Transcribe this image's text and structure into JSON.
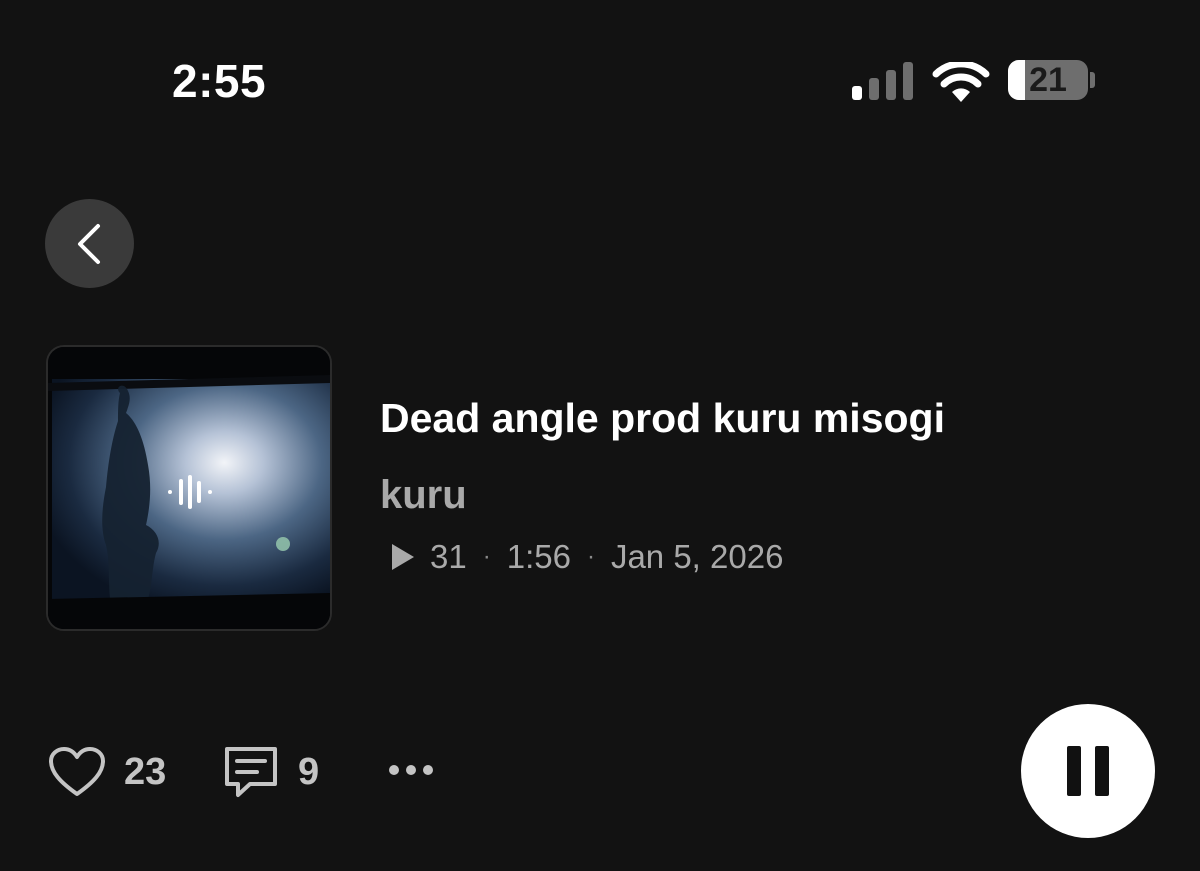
{
  "status_bar": {
    "time": "2:55",
    "battery_level": "21",
    "battery_fraction": 0.21,
    "icons": [
      "cellular-signal-icon",
      "wifi-icon",
      "battery-icon"
    ]
  },
  "nav": {
    "back_icon": "chevron-left-icon"
  },
  "track": {
    "title": "Dead angle prod kuru misogi",
    "artist": "kuru",
    "plays": "31",
    "duration": "1:56",
    "date": "Jan 5, 2026",
    "separator": "·"
  },
  "actions": {
    "likes": "23",
    "comments": "9",
    "like_icon": "heart-icon",
    "comment_icon": "comment-icon",
    "more_icon": "more-horizontal-icon",
    "pause_icon": "pause-icon"
  },
  "colors": {
    "background": "#121212",
    "primary_text": "#ffffff",
    "secondary_text": "#a9a9a9",
    "button_bg": "#3a3a3a"
  }
}
